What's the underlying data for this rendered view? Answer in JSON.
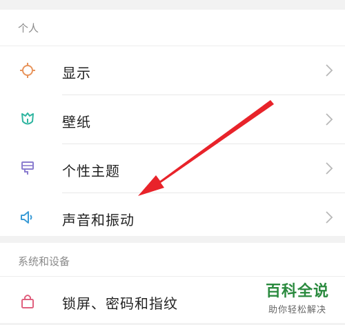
{
  "personal": {
    "header": "个人",
    "items": [
      {
        "label": "显示",
        "icon": "sun-icon"
      },
      {
        "label": "壁纸",
        "icon": "wallpaper-tulip-icon"
      },
      {
        "label": "个性主题",
        "icon": "theme-brush-icon"
      },
      {
        "label": "声音和振动",
        "icon": "speaker-icon"
      }
    ]
  },
  "system": {
    "header": "系统和设备",
    "items": [
      {
        "label": "锁屏、密码和指纹",
        "icon": "lock-icon"
      }
    ]
  },
  "watermark": {
    "title": "百科全说",
    "subtitle": "助你轻松解决"
  },
  "colors": {
    "display_icon": "#e8935a",
    "wallpaper_icon": "#2fb5a0",
    "theme_icon": "#8a7ccf",
    "sound_icon": "#3a9bd6",
    "lock_icon": "#e0607e",
    "annotation_arrow": "#e8232a",
    "watermark_green": "#2a8a3e"
  }
}
